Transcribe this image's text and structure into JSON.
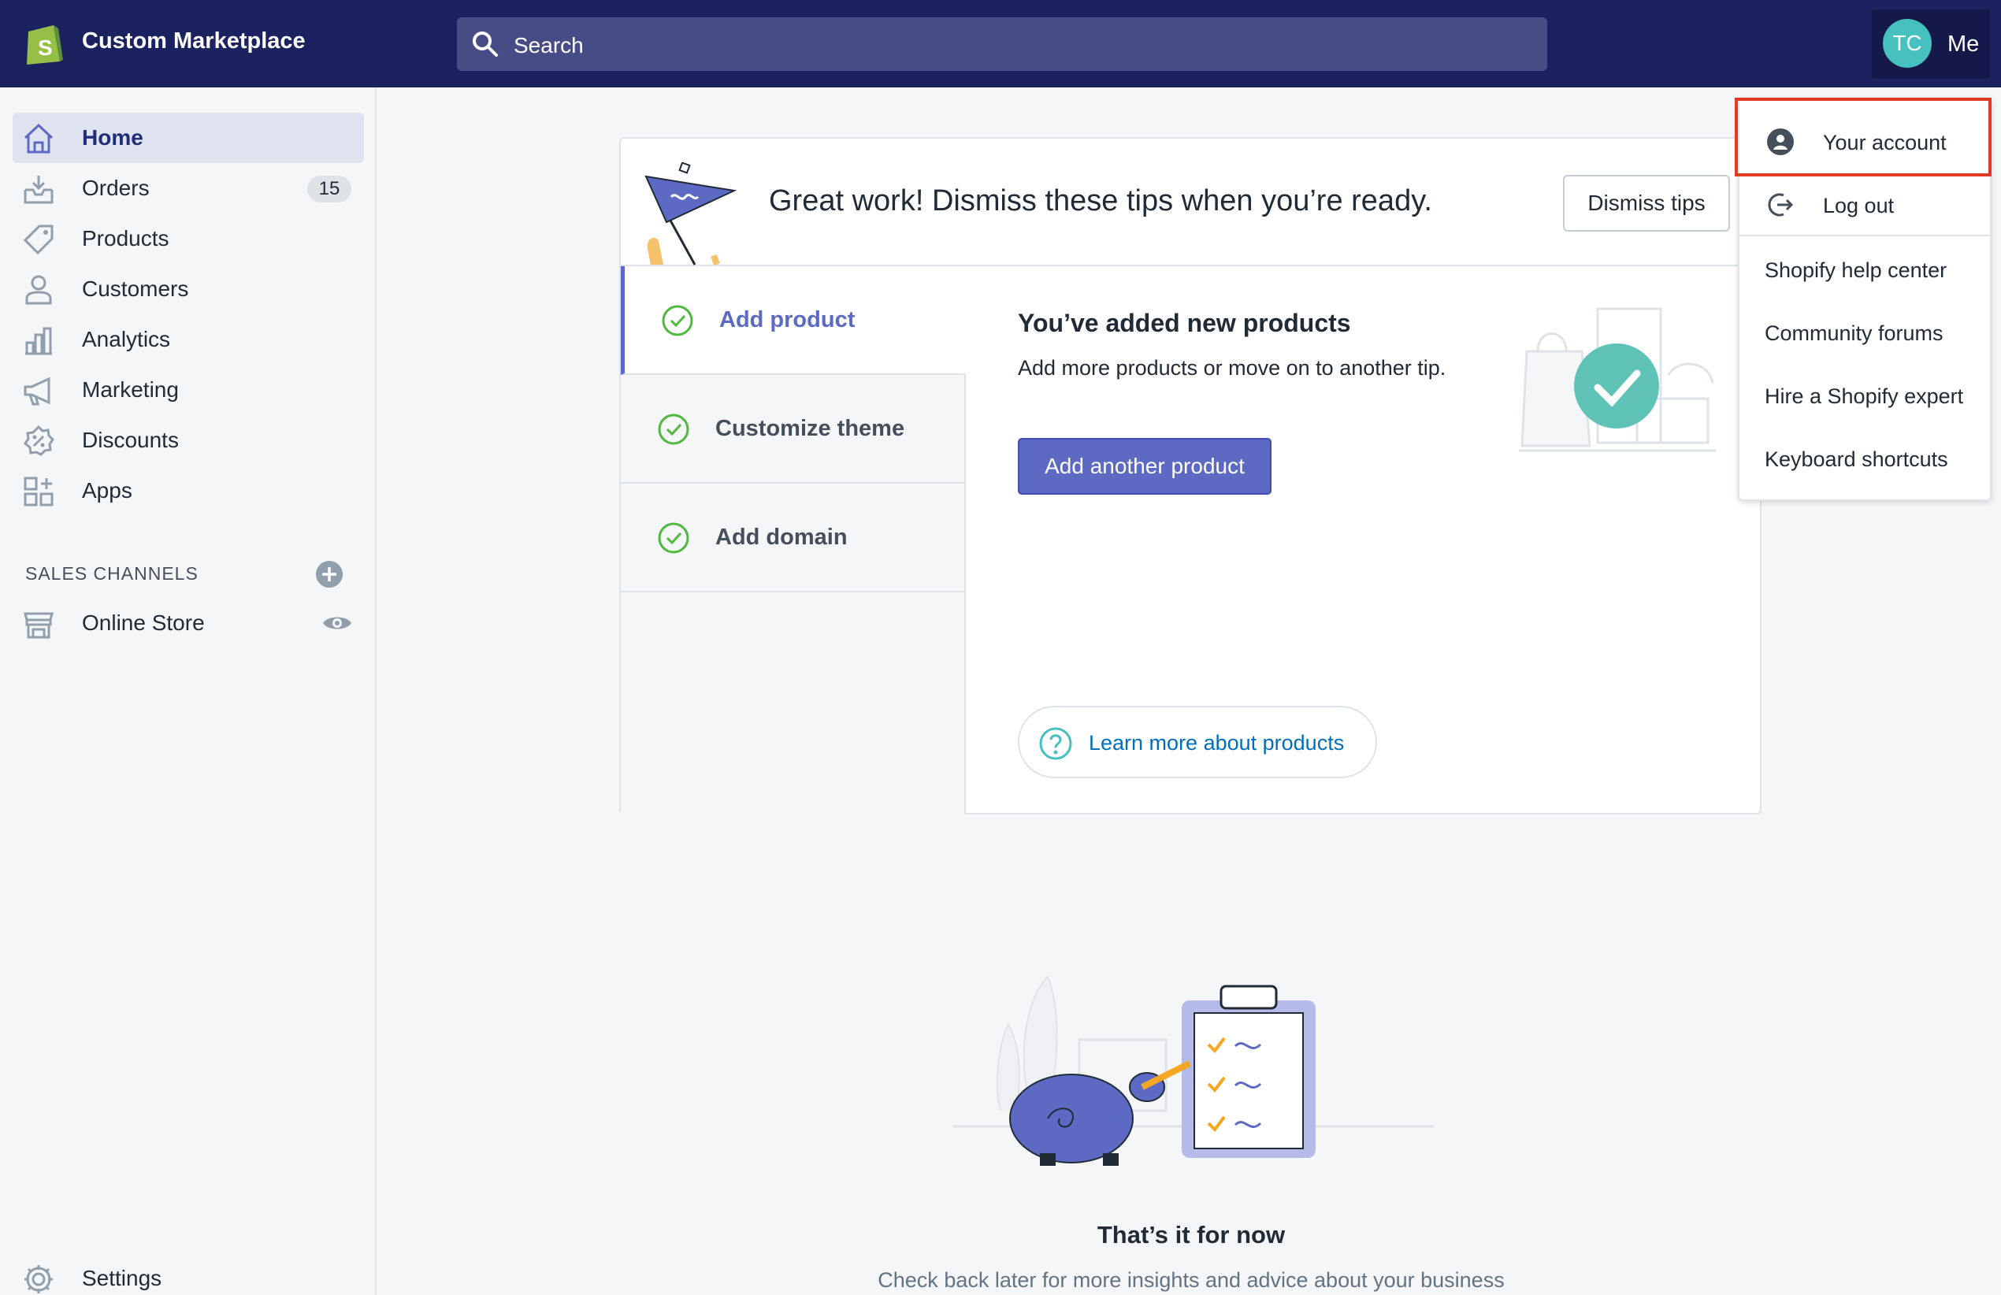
{
  "topbar": {
    "store_name": "Custom Marketplace",
    "search_placeholder": "Search",
    "avatar_initials": "TC",
    "account_label": "Me"
  },
  "sidebar": {
    "items": [
      {
        "label": "Home",
        "icon": "home-icon",
        "active": true
      },
      {
        "label": "Orders",
        "icon": "orders-icon",
        "badge": "15"
      },
      {
        "label": "Products",
        "icon": "tag-icon"
      },
      {
        "label": "Customers",
        "icon": "person-icon"
      },
      {
        "label": "Analytics",
        "icon": "bar-chart-icon"
      },
      {
        "label": "Marketing",
        "icon": "megaphone-icon"
      },
      {
        "label": "Discounts",
        "icon": "discount-icon"
      },
      {
        "label": "Apps",
        "icon": "apps-icon"
      }
    ],
    "sales_channels_title": "SALES CHANNELS",
    "online_store": "Online Store",
    "settings": "Settings"
  },
  "tips_card": {
    "banner": "Great work! Dismiss these tips when you’re ready.",
    "dismiss_label": "Dismiss tips",
    "tabs": [
      {
        "label": "Add product",
        "active": true
      },
      {
        "label": "Customize theme"
      },
      {
        "label": "Add domain"
      }
    ],
    "content_title": "You’ve added new products",
    "content_desc": "Add more products or move on to another tip.",
    "primary_button": "Add another product",
    "learn_more": "Learn more about products"
  },
  "empty_state": {
    "title": "That’s it for now",
    "subtitle": "Check back later for more insights and advice about your business"
  },
  "account_menu": {
    "items": [
      "Your account",
      "Log out",
      "Shopify help center",
      "Community forums",
      "Hire a Shopify expert",
      "Keyboard shortcuts"
    ]
  },
  "colors": {
    "topbar": "#1c2260",
    "accent": "#5c6ac4",
    "success": "#50b83c",
    "highlight": "#e03b24"
  }
}
